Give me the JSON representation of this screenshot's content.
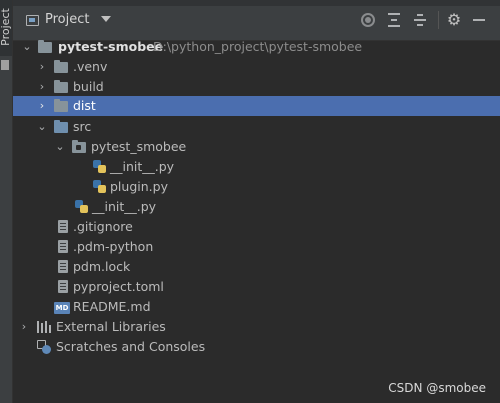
{
  "window": {
    "side_tab_label": "Project"
  },
  "header": {
    "title": "Project",
    "icons": [
      "locate-target-icon",
      "expand-all-icon",
      "collapse-all-icon",
      "gear-icon",
      "minimize-icon"
    ]
  },
  "tree": {
    "root": {
      "label": "pytest-smobee",
      "path": "D:\\python_project\\pytest-smobee",
      "expanded": true
    },
    "venv": {
      "label": ".venv",
      "expanded": false
    },
    "build": {
      "label": "build",
      "expanded": false
    },
    "dist": {
      "label": "dist",
      "expanded": false,
      "selected": true
    },
    "src": {
      "label": "src",
      "expanded": true
    },
    "pkg": {
      "label": "pytest_smobee",
      "expanded": true
    },
    "pkg_init": {
      "label": "__init__.py"
    },
    "plugin": {
      "label": "plugin.py"
    },
    "src_init": {
      "label": "__init__.py"
    },
    "gitignore": {
      "label": ".gitignore"
    },
    "pdm_python": {
      "label": ".pdm-python"
    },
    "pdm_lock": {
      "label": "pdm.lock"
    },
    "pyproject": {
      "label": "pyproject.toml"
    },
    "readme": {
      "label": "README.md",
      "icon_text": "MD"
    },
    "ext_libs": {
      "label": "External Libraries",
      "expanded": false
    },
    "scratches": {
      "label": "Scratches and Consoles"
    }
  },
  "watermark": "CSDN @smobee",
  "colors": {
    "background": "#2b2b2b",
    "selection": "#4b6eaf",
    "text": "#bbbbbb"
  }
}
